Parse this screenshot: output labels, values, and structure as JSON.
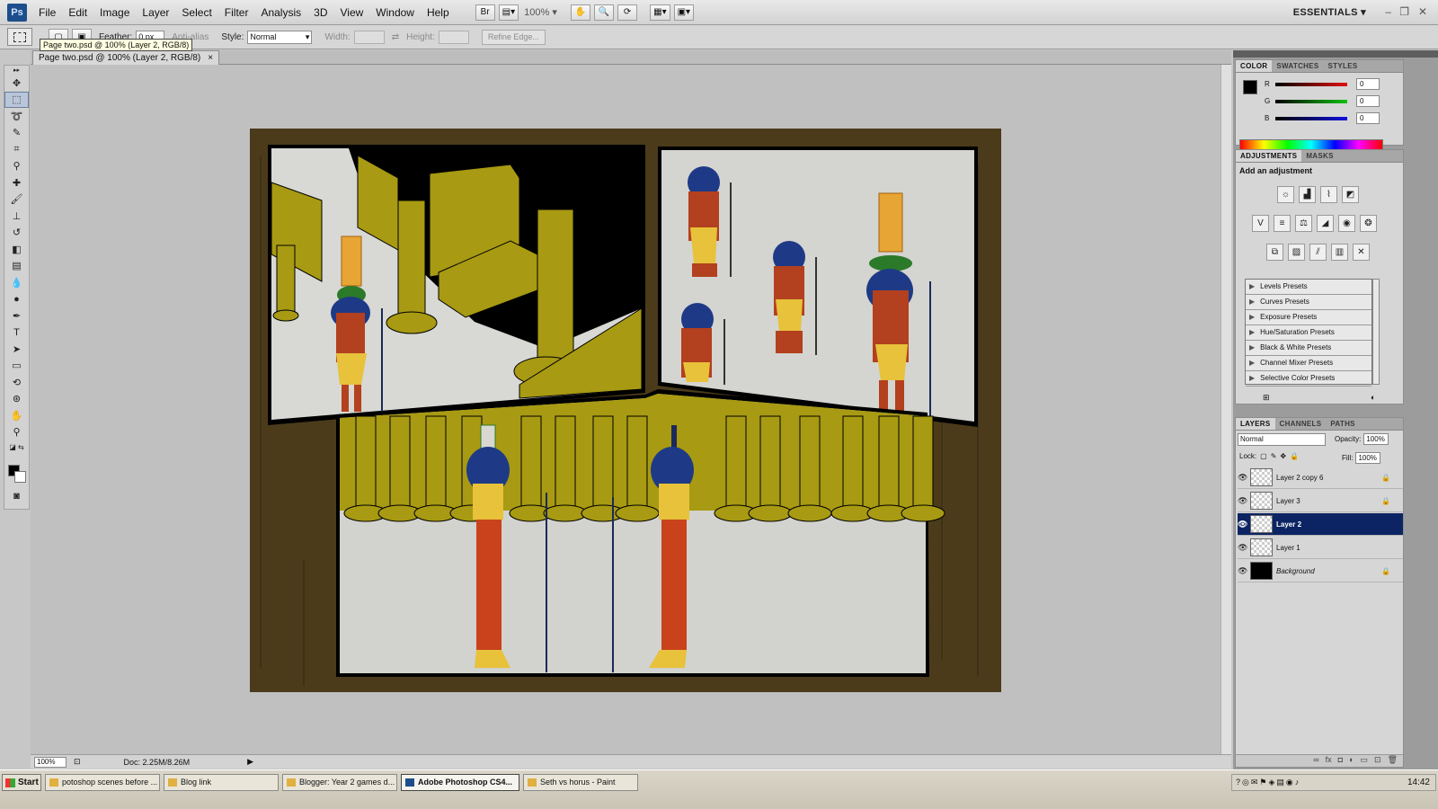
{
  "app": {
    "logo": "Ps",
    "menu": [
      "File",
      "Edit",
      "Image",
      "Layer",
      "Select",
      "Filter",
      "Analysis",
      "3D",
      "View",
      "Window",
      "Help"
    ],
    "zoom_display": "100%",
    "workspace": "ESSENTIALS"
  },
  "options_bar": {
    "feather_label": "Feather:",
    "feather_value": "0 px",
    "antialias_label": "Anti-alias",
    "style_label": "Style:",
    "style_value": "Normal",
    "width_label": "Width:",
    "height_label": "Height:",
    "refine_edge": "Refine Edge..."
  },
  "tooltip": "Page two.psd @ 100% (Layer 2, RGB/8)",
  "document": {
    "tab_title": "Page two.psd @ 100% (Layer 2, RGB/8)",
    "close_glyph": "×",
    "zoom": "100%",
    "doc_size": "Doc: 2.25M/8.26M"
  },
  "color_panel": {
    "tabs": [
      "COLOR",
      "SWATCHES",
      "STYLES"
    ],
    "channels": [
      {
        "label": "R",
        "value": "0",
        "color": "#e01010"
      },
      {
        "label": "G",
        "value": "0",
        "color": "#10c010"
      },
      {
        "label": "B",
        "value": "0",
        "color": "#1010e0"
      }
    ]
  },
  "adjustments_panel": {
    "tabs": [
      "ADJUSTMENTS",
      "MASKS"
    ],
    "title": "Add an adjustment",
    "presets": [
      "Levels Presets",
      "Curves Presets",
      "Exposure Presets",
      "Hue/Saturation Presets",
      "Black & White Presets",
      "Channel Mixer Presets",
      "Selective Color Presets"
    ]
  },
  "layers_panel": {
    "tabs": [
      "LAYERS",
      "CHANNELS",
      "PATHS"
    ],
    "blend_mode": "Normal",
    "opacity_label": "Opacity:",
    "opacity_value": "100%",
    "lock_label": "Lock:",
    "fill_label": "Fill:",
    "fill_value": "100%",
    "layers": [
      {
        "name": "Layer 2 copy 6",
        "locked": true,
        "selected": false
      },
      {
        "name": "Layer 3",
        "locked": true,
        "selected": false
      },
      {
        "name": "Layer 2",
        "locked": false,
        "selected": true
      },
      {
        "name": "Layer 1",
        "locked": false,
        "selected": false
      },
      {
        "name": "Background",
        "locked": true,
        "selected": false
      }
    ]
  },
  "taskbar": {
    "start": "Start",
    "tasks": [
      {
        "label": "potoshop scenes before ...",
        "active": false
      },
      {
        "label": "Blog link",
        "active": false
      },
      {
        "label": "Blogger: Year 2 games d...",
        "active": false
      },
      {
        "label": "Adobe Photoshop CS4...",
        "active": true
      },
      {
        "label": "Seth vs horus - Paint",
        "active": false
      }
    ],
    "clock": "14:42"
  },
  "colors": {
    "gold": "#a89a12",
    "dark_gold": "#6e6508",
    "floor": "#d4d4d0",
    "skin_red": "#b3401e",
    "skin_yellow": "#e7c23a",
    "selected_layer": "#0c2463"
  }
}
